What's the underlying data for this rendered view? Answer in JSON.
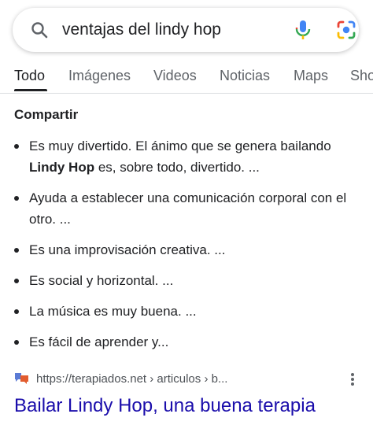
{
  "search": {
    "query": "ventajas del lindy hop"
  },
  "tabs": [
    "Todo",
    "Imágenes",
    "Videos",
    "Noticias",
    "Maps",
    "Sho"
  ],
  "section": {
    "title": "Compartir",
    "bullets": [
      {
        "pre": "Es muy divertido. El ánimo que se genera bailando ",
        "bold": "Lindy Hop",
        "post": " es, sobre todo, divertido. ..."
      },
      {
        "pre": "Ayuda a establecer una comunicación corporal con el otro. ...",
        "bold": "",
        "post": ""
      },
      {
        "pre": "Es una improvisación creativa. ...",
        "bold": "",
        "post": ""
      },
      {
        "pre": "Es social y horizontal. ...",
        "bold": "",
        "post": ""
      },
      {
        "pre": "La música es muy buena. ...",
        "bold": "",
        "post": ""
      },
      {
        "pre": "Es fácil de aprender y...",
        "bold": "",
        "post": ""
      }
    ]
  },
  "result": {
    "url": "https://terapiados.net › articulos › b...",
    "title": "Bailar Lindy Hop, una buena terapia"
  },
  "colors": {
    "link": "#1a0dab",
    "text": "#202124",
    "muted": "#5f6368"
  },
  "icons": [
    "search-icon",
    "mic-icon",
    "google-lens-icon",
    "site-favicon",
    "more-options-icon"
  ]
}
